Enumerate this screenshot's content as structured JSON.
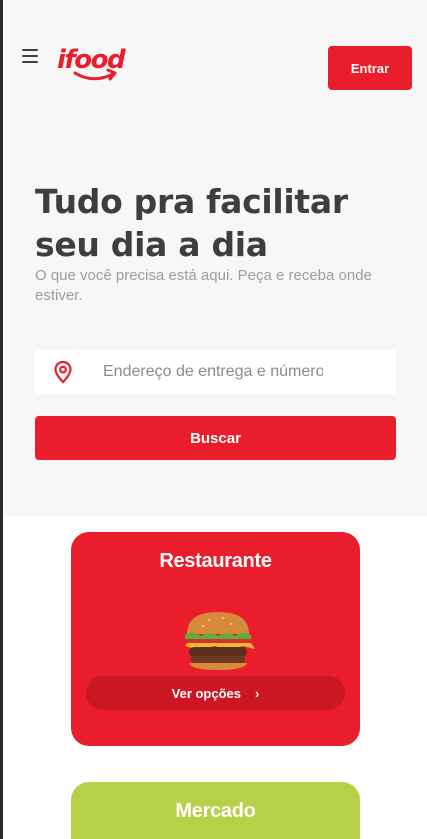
{
  "header": {
    "logo_text": "ifood",
    "login_label": "Entrar"
  },
  "hero": {
    "title": "Tudo pra facilitar seu dia a dia",
    "subtitle": "O que você precisa está aqui. Peça e receba onde estiver.",
    "address_placeholder": "Endereço de entrega e número",
    "search_label": "Buscar"
  },
  "categories": [
    {
      "title": "Restaurante",
      "button_label": "Ver opções",
      "color": "#ea1d2c"
    },
    {
      "title": "Mercado",
      "color": "#b6d048"
    }
  ],
  "colors": {
    "brand": "#ea1d2c",
    "text_dark": "#3e3e3e",
    "text_muted": "#9d9d9d"
  }
}
